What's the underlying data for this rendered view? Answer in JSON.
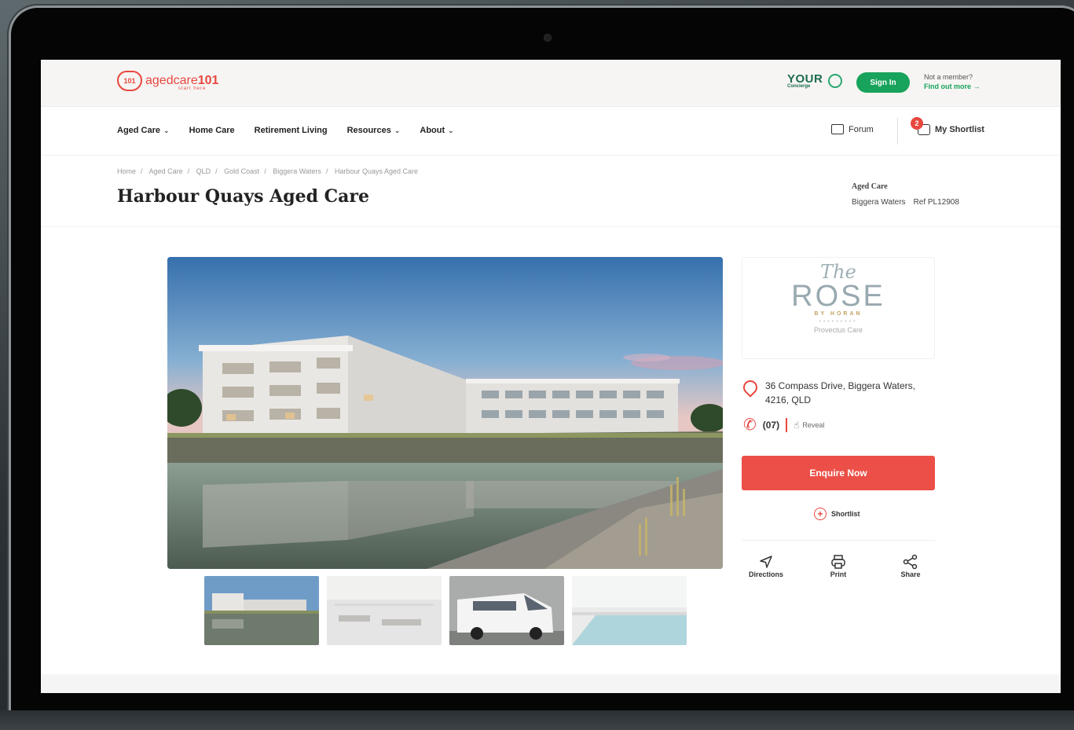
{
  "header": {
    "logo_badge": "101",
    "logo_text_a": "agedcare",
    "logo_text_b": "101",
    "logo_tagline": "start here",
    "concierge_big": "YOUR",
    "concierge_small": "Concierge",
    "signin_label": "Sign In",
    "member_question": "Not a member?",
    "member_link": "Find out more →"
  },
  "nav": {
    "items": [
      {
        "label": "Aged Care",
        "dropdown": true
      },
      {
        "label": "Home Care",
        "dropdown": false
      },
      {
        "label": "Retirement Living",
        "dropdown": false
      },
      {
        "label": "Resources",
        "dropdown": true
      },
      {
        "label": "About",
        "dropdown": true
      }
    ],
    "forum_label": "Forum",
    "shortlist_label": "My Shortlist",
    "shortlist_count": "2"
  },
  "breadcrumb": [
    "Home",
    "Aged Care",
    "QLD",
    "Gold Coast",
    "Biggera Waters",
    "Harbour Quays Aged Care"
  ],
  "page": {
    "title": "Harbour Quays Aged Care",
    "type": "Aged Care",
    "suburb": "Biggera Waters",
    "ref": "Ref PL12908"
  },
  "provider": {
    "script": "The",
    "name": "ROSE",
    "by": "BY HORAN",
    "provider_name": "Provectus Care"
  },
  "contact": {
    "address": "36 Compass Drive, Biggera Waters, 4216, QLD",
    "phone_prefix": "(07)",
    "reveal_label": "Reveal"
  },
  "cta": {
    "enquire_label": "Enquire Now",
    "shortlist_label": "Shortlist"
  },
  "actions": [
    {
      "label": "Directions",
      "icon": "navigation-arrow-icon"
    },
    {
      "label": "Print",
      "icon": "printer-icon"
    },
    {
      "label": "Share",
      "icon": "share-icon"
    }
  ],
  "gallery": {
    "thumbnails": [
      "building-exterior",
      "dining-room",
      "minibus",
      "swimming-pool"
    ]
  },
  "colors": {
    "brand_red": "#e8473f",
    "brand_green": "#17a35b",
    "enquire_red": "#ec4f47"
  }
}
